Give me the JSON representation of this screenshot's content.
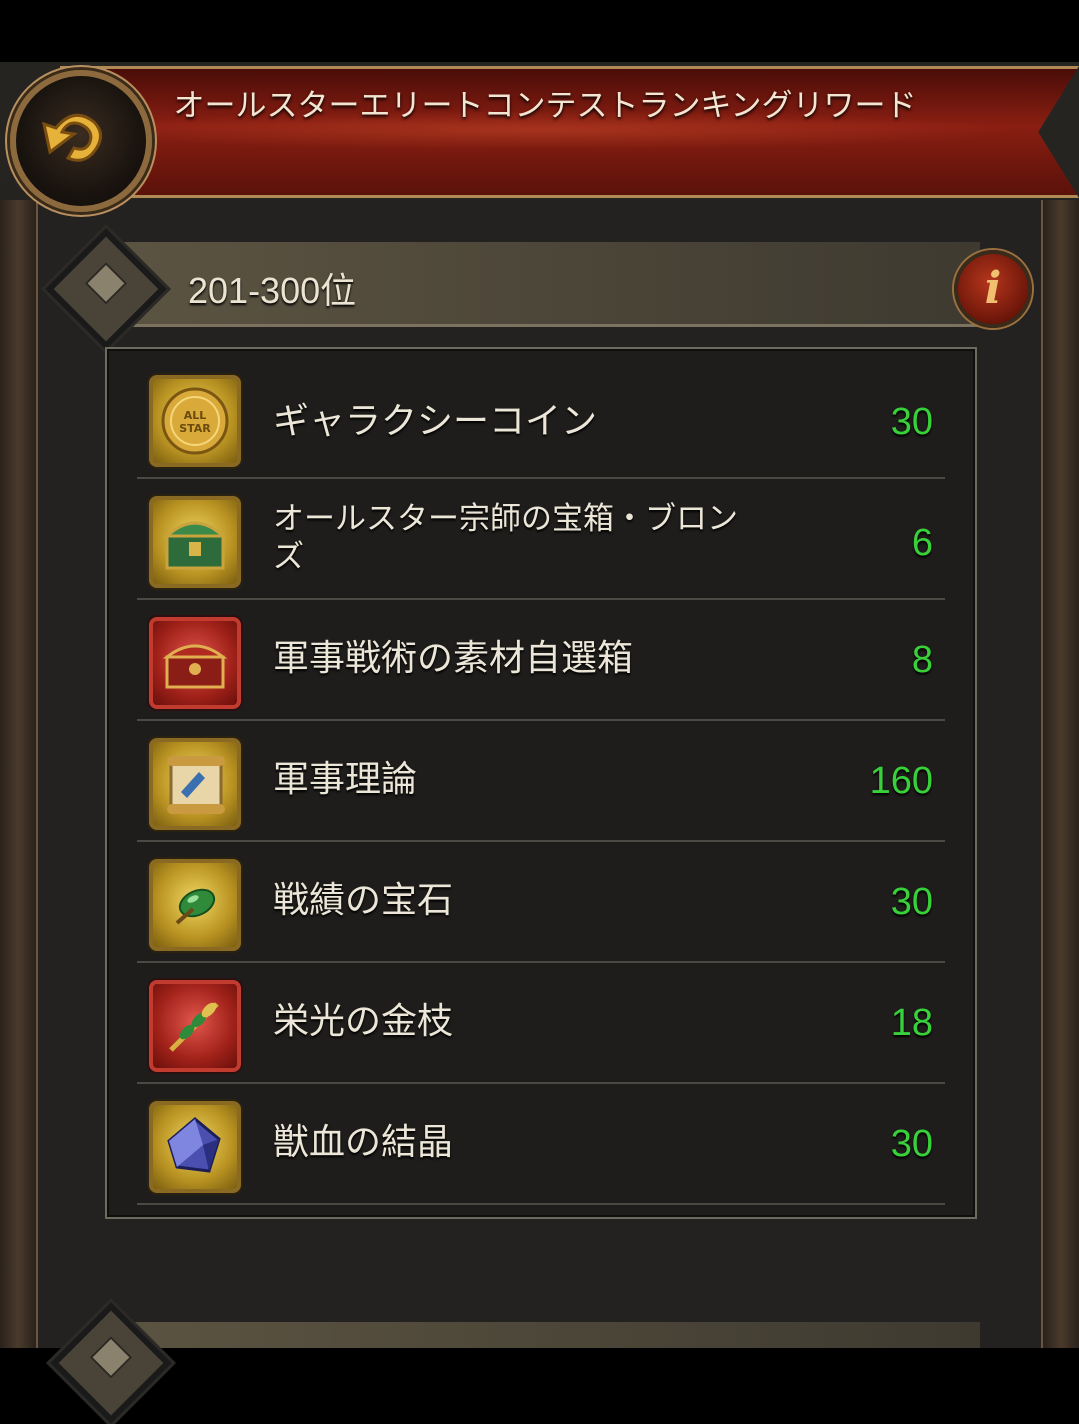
{
  "header": {
    "title": "オールスターエリートコンテストランキングリワード"
  },
  "section": {
    "rank_label": "201-300位"
  },
  "rewards": [
    {
      "name": "ギャラクシーコイン",
      "qty": "30",
      "icon": "all-star-coin-icon",
      "frame": "gold"
    },
    {
      "name": "オールスター宗師の宝箱・ブロンズ",
      "qty": "6",
      "icon": "treasure-chest-icon",
      "frame": "gold"
    },
    {
      "name": "軍事戦術の素材自選箱",
      "qty": "8",
      "icon": "red-chest-icon",
      "frame": "red"
    },
    {
      "name": "軍事理論",
      "qty": "160",
      "icon": "scroll-icon",
      "frame": "gold"
    },
    {
      "name": "戦績の宝石",
      "qty": "30",
      "icon": "green-gem-icon",
      "frame": "gold"
    },
    {
      "name": "栄光の金枝",
      "qty": "18",
      "icon": "golden-branch-icon",
      "frame": "red"
    },
    {
      "name": "獣血の結晶",
      "qty": "30",
      "icon": "crystal-icon",
      "frame": "gold"
    }
  ],
  "colors": {
    "qty_green": "#39d13a",
    "banner_red": "#8a1e12",
    "gold_frame": "#b99322",
    "red_frame": "#a1221a"
  }
}
